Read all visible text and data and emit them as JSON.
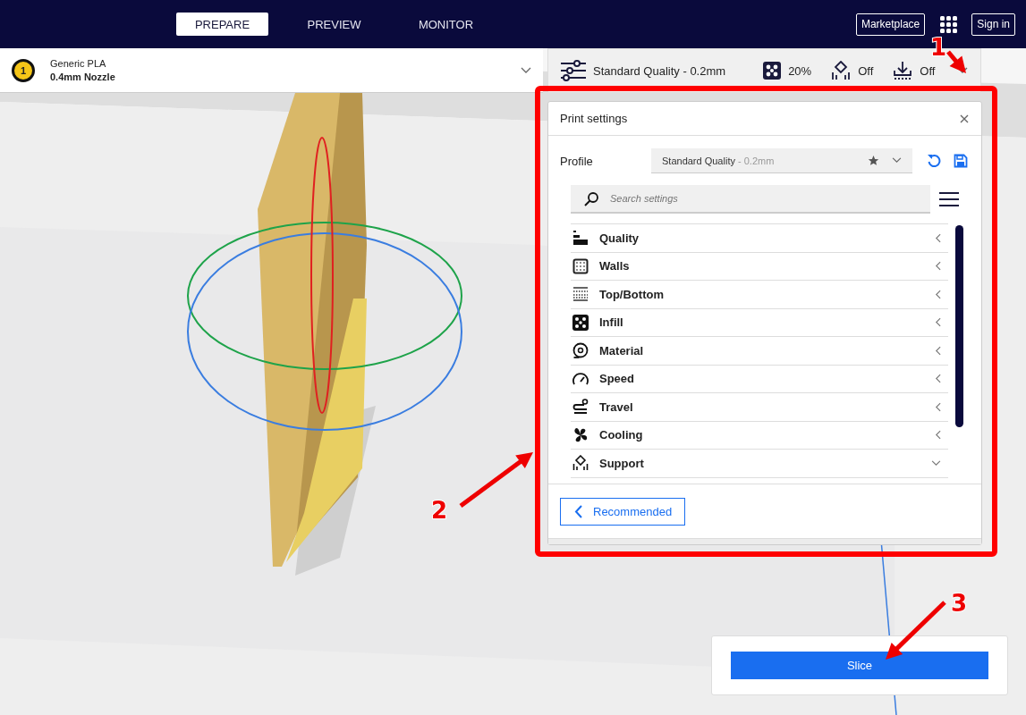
{
  "header": {
    "tabs": [
      {
        "label": "PREPARE",
        "selected": true
      },
      {
        "label": "PREVIEW",
        "selected": false
      },
      {
        "label": "MONITOR",
        "selected": false
      }
    ],
    "marketplace_button": "Marketplace",
    "sign_in_button": "Sign in"
  },
  "extruder": {
    "number": "1",
    "material": "Generic PLA",
    "nozzle": "0.4mm Nozzle"
  },
  "print_setup_bar": {
    "profile": "Standard Quality - 0.2mm",
    "infill": "20%",
    "support": "Off",
    "adhesion": "Off"
  },
  "print_settings": {
    "title": "Print settings",
    "profile_label": "Profile",
    "profile_value": "Standard Quality",
    "profile_suffix": "- 0.2mm",
    "search_placeholder": "Search settings",
    "categories": [
      {
        "kind": "quality",
        "label": "Quality",
        "expanded": false
      },
      {
        "kind": "walls",
        "label": "Walls",
        "expanded": false
      },
      {
        "kind": "topbottom",
        "label": "Top/Bottom",
        "expanded": false
      },
      {
        "kind": "infill",
        "label": "Infill",
        "expanded": false
      },
      {
        "kind": "material",
        "label": "Material",
        "expanded": false
      },
      {
        "kind": "speed",
        "label": "Speed",
        "expanded": false
      },
      {
        "kind": "travel",
        "label": "Travel",
        "expanded": false
      },
      {
        "kind": "cooling",
        "label": "Cooling",
        "expanded": false
      },
      {
        "kind": "support",
        "label": "Support",
        "expanded": true
      }
    ],
    "mode_button": "Recommended"
  },
  "slice_button": "Slice",
  "annotations": [
    {
      "number": "1"
    },
    {
      "number": "2"
    },
    {
      "number": "3"
    }
  ]
}
